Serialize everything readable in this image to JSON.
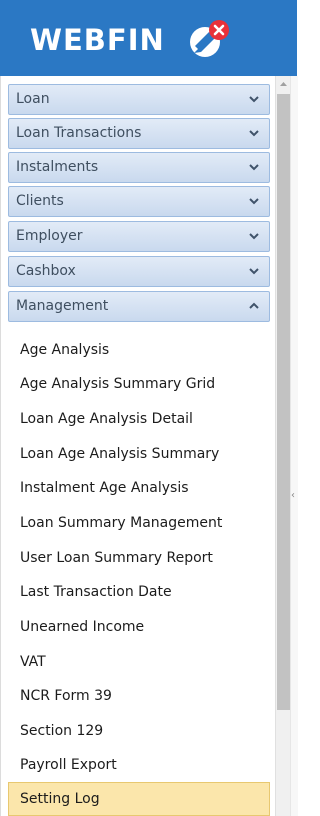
{
  "brand": {
    "name": "WEBFIN"
  },
  "menu": {
    "sections": [
      {
        "label": "Loan",
        "state": "collapsed"
      },
      {
        "label": "Loan Transactions",
        "state": "collapsed"
      },
      {
        "label": "Instalments",
        "state": "collapsed"
      },
      {
        "label": "Clients",
        "state": "collapsed"
      },
      {
        "label": "Employer",
        "state": "collapsed"
      },
      {
        "label": "Cashbox",
        "state": "collapsed"
      },
      {
        "label": "Management",
        "state": "expanded"
      }
    ],
    "management_items": [
      "Age Analysis",
      "Age Analysis Summary Grid",
      "Loan Age Analysis Detail",
      "Loan Age Analysis Summary",
      "Instalment Age Analysis",
      "Loan Summary Management",
      "User Loan Summary Report",
      "Last Transaction Date",
      "Unearned Income",
      "VAT",
      "NCR Form 39",
      "Section 129",
      "Payroll Export",
      "Setting Log"
    ],
    "selected_item": "Setting Log"
  },
  "icons": {
    "logo": "rocket-cross-icon",
    "collapsed_chevron": "chevron-down-icon",
    "expanded_chevron": "chevron-up-icon",
    "scroll_up": "arrow-up-icon"
  },
  "colors": {
    "header_bg": "#2b78c4",
    "section_bg": "#c9d9ee",
    "selected_bg": "#fbe6ab",
    "logo_badge": "#e8313a"
  }
}
